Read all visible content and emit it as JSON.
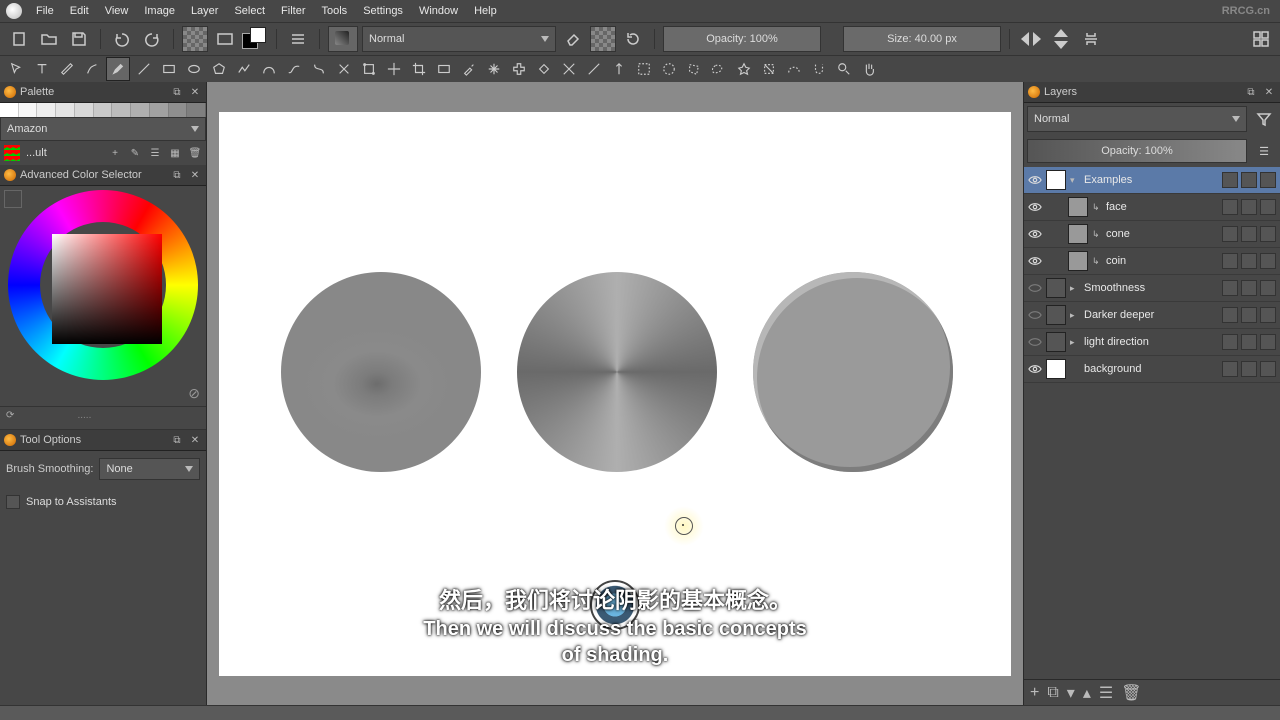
{
  "menu": {
    "items": [
      "File",
      "Edit",
      "View",
      "Image",
      "Layer",
      "Select",
      "Filter",
      "Tools",
      "Settings",
      "Window",
      "Help"
    ]
  },
  "watermark": "RRCG.cn",
  "toolbar": {
    "mode_label": "Normal",
    "opacity_label": "Opacity: 100%",
    "size_label": "Size: 40.00 px"
  },
  "tool_icons": [
    "new-doc-icon",
    "open-icon",
    "save-icon",
    "undo-icon",
    "redo-icon"
  ],
  "palette": {
    "title": "Palette",
    "preset": "Amazon",
    "file": "...ult",
    "swatches": [
      "#ffffff",
      "#f7f7f7",
      "#eeeeee",
      "#e4e4e4",
      "#d8d8d8",
      "#c9c9c9",
      "#bcbcbc",
      "#afafaf",
      "#a1a1a1",
      "#8f8f8f",
      "#7f7f7f"
    ]
  },
  "color_selector": {
    "title": "Advanced Color Selector"
  },
  "tool_options": {
    "title": "Tool Options",
    "smoothing_label": "Brush Smoothing:",
    "smoothing_value": "None",
    "snap_label": "Snap to Assistants"
  },
  "layers": {
    "title": "Layers",
    "blend": "Normal",
    "opacity": "Opacity:  100%",
    "items": [
      "Examples",
      "face",
      "cone",
      "coin",
      "Smoothness",
      "Darker deeper",
      "light direction",
      "background"
    ]
  },
  "subtitles": {
    "cn": "然后，我们将讨论阴影的基本概念。",
    "en": "Then we will discuss the basic concepts of shading."
  },
  "colors": {
    "panel": "#474747",
    "accent": "#5b7aa8"
  }
}
